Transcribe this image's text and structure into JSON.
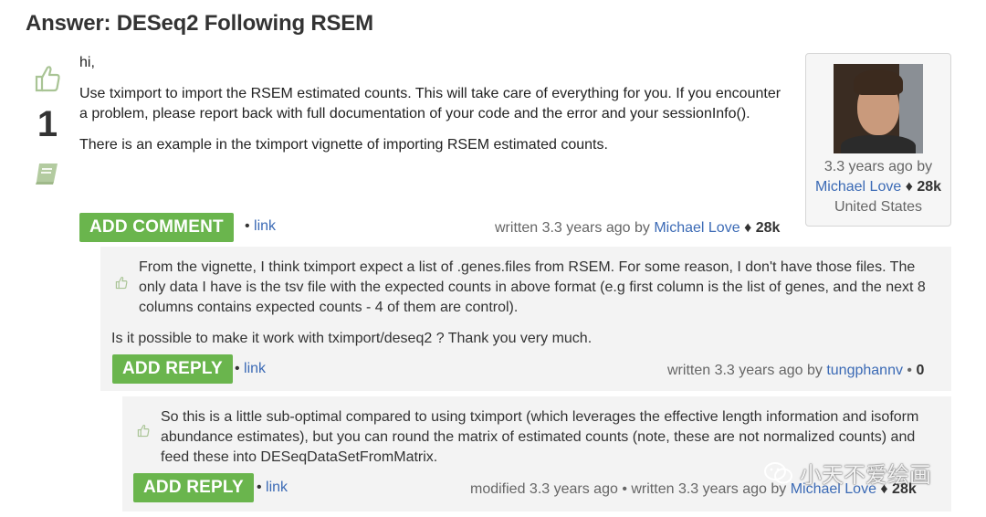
{
  "page": {
    "title": "Answer: DESeq2 Following RSEM"
  },
  "answer": {
    "votes": "1",
    "paragraphs": [
      "hi,",
      "Use tximport to import the RSEM estimated counts. This will take care of everything for you. If you encounter a problem, please report back with full documentation of your code and the error and your sessionInfo().",
      "There is an example in the tximport vignette of importing RSEM estimated counts."
    ],
    "add_comment_label": "ADD COMMENT",
    "link_label": "link",
    "meta_prefix": "written 3.3 years ago by",
    "author": "Michael Love",
    "rep": "28k",
    "rep_diamond": "♦"
  },
  "user_card": {
    "age": "3.3 years ago by",
    "name": "Michael Love",
    "diamond": "♦",
    "rep": "28k",
    "location": "United States"
  },
  "comment1": {
    "text_indented": "From the vignette, I think tximport expect a list of .genes.files from RSEM. For some reason, I don't have those files. The only data I have is the tsv file with the expected counts in above format (e.g first column is the list of genes, and the next 8 columns contains expected counts - 4 of them are control).",
    "text_full": "Is it possible to make it work with tximport/deseq2 ? Thank you very much.",
    "reply_label": "ADD REPLY",
    "link_label": "link",
    "meta_prefix": "written 3.3 years ago by",
    "author": "tungphannv",
    "bullet": "•",
    "rep": "0"
  },
  "comment2": {
    "text": "So this is a little sub-optimal compared to using tximport (which leverages the effective length information and isoform abundance estimates), but you can round the matrix of estimated counts (note, these are not normalized counts) and feed these into DESeqDataSetFromMatrix.",
    "reply_label": "ADD REPLY",
    "link_label": "link",
    "meta_prefix": "modified 3.3 years ago • written 3.3 years ago by",
    "author": "Michael Love",
    "diamond": "♦",
    "rep": "28k"
  },
  "watermark": {
    "text": "小天不爱绘画"
  },
  "colors": {
    "button_green": "#6ab54d",
    "link_blue": "#3b6ab5",
    "comment_bg": "#f3f3f3"
  }
}
